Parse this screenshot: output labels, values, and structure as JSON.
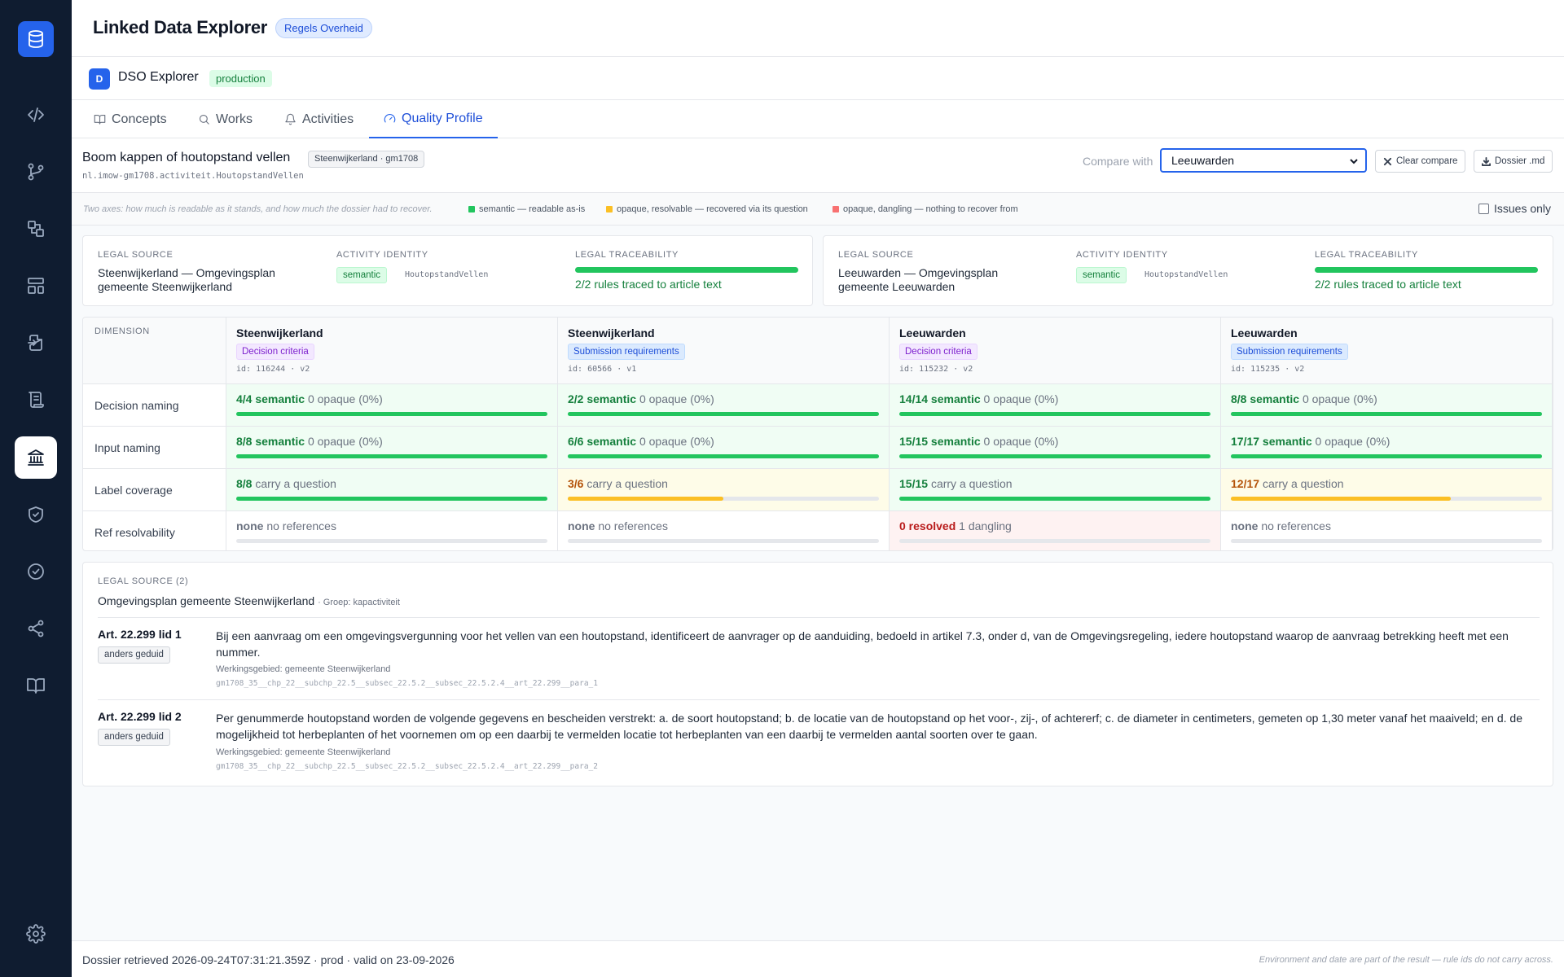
{
  "app": {
    "title": "Linked Data Explorer",
    "context_badge": "Regels Overheid"
  },
  "sidebar": {
    "items": [
      {
        "name": "code-icon"
      },
      {
        "name": "git-branch-icon"
      },
      {
        "name": "shapes-icon"
      },
      {
        "name": "layout-icon"
      },
      {
        "name": "file-import-icon"
      },
      {
        "name": "scroll-icon"
      },
      {
        "name": "landmark-icon",
        "active": true
      },
      {
        "name": "shield-check-icon"
      },
      {
        "name": "circle-check-icon"
      },
      {
        "name": "share-icon"
      },
      {
        "name": "book-open-icon"
      },
      {
        "name": "settings-icon"
      }
    ]
  },
  "environment": {
    "avatar": "D",
    "name": "DSO Explorer",
    "badge": "production"
  },
  "tabs": [
    {
      "label": "Concepts",
      "icon": "book-icon"
    },
    {
      "label": "Works",
      "icon": "search-icon"
    },
    {
      "label": "Activities",
      "icon": "bell-icon"
    },
    {
      "label": "Quality Profile",
      "icon": "gauge-icon",
      "active": true
    }
  ],
  "activity": {
    "title": "Boom kappen of houtopstand vellen",
    "chip": "Steenwijkerland · gm1708",
    "id": "nl.imow-gm1708.activiteit.HoutopstandVellen"
  },
  "compare": {
    "label": "Compare with",
    "selected": "Leeuwarden",
    "clear_label": "Clear compare",
    "dossier_label": "Dossier .md"
  },
  "legend": {
    "intro": "Two axes: how much is readable as it stands, and how much the dossier had to recover.",
    "items": [
      {
        "label": "semantic — readable as-is",
        "color": "#22c55e"
      },
      {
        "label": "opaque, resolvable — recovered via its question",
        "color": "#fbbf24"
      },
      {
        "label": "opaque, dangling — nothing to recover from",
        "color": "#f87171"
      }
    ],
    "issues_only": "Issues only"
  },
  "cards": [
    {
      "legal_source_label": "LEGAL SOURCE",
      "legal_source": "Steenwijkerland — Omgevingsplan gemeente Steenwijkerland",
      "identity_label": "ACTIVITY IDENTITY",
      "identity_badge": "semantic",
      "identity_id": "HoutopstandVellen",
      "trace_label": "LEGAL TRACEABILITY",
      "trace_text": "2/2 rules traced to article text",
      "trace_fraction": 1.0
    },
    {
      "legal_source_label": "LEGAL SOURCE",
      "legal_source": "Leeuwarden — Omgevingsplan gemeente Leeuwarden",
      "identity_label": "ACTIVITY IDENTITY",
      "identity_badge": "semantic",
      "identity_id": "HoutopstandVellen",
      "trace_label": "LEGAL TRACEABILITY",
      "trace_text": "2/2 rules traced to article text",
      "trace_fraction": 1.0
    }
  ],
  "matrix": {
    "dimension_header": "DIMENSION",
    "columns": [
      {
        "name": "Steenwijkerland",
        "badge": "Decision criteria",
        "badge_tone": "purple",
        "id": "id: 116244 · v2"
      },
      {
        "name": "Steenwijkerland",
        "badge": "Submission requirements",
        "badge_tone": "blue",
        "id": "id: 60566 · v1"
      },
      {
        "name": "Leeuwarden",
        "badge": "Decision criteria",
        "badge_tone": "purple",
        "id": "id: 115232 · v2"
      },
      {
        "name": "Leeuwarden",
        "badge": "Submission requirements",
        "badge_tone": "blue",
        "id": "id: 115235 · v2"
      }
    ],
    "rows": [
      {
        "label": "Decision naming",
        "cells": [
          {
            "strong": "4/4 semantic",
            "rest": "0 opaque (0%)",
            "tone": "green",
            "fill": 1.0,
            "fill_color": "#22c55e"
          },
          {
            "strong": "2/2 semantic",
            "rest": "0 opaque (0%)",
            "tone": "green",
            "fill": 1.0,
            "fill_color": "#22c55e"
          },
          {
            "strong": "14/14 semantic",
            "rest": "0 opaque (0%)",
            "tone": "green",
            "fill": 1.0,
            "fill_color": "#22c55e"
          },
          {
            "strong": "8/8 semantic",
            "rest": "0 opaque (0%)",
            "tone": "green",
            "fill": 1.0,
            "fill_color": "#22c55e"
          }
        ]
      },
      {
        "label": "Input naming",
        "cells": [
          {
            "strong": "8/8 semantic",
            "rest": "0 opaque (0%)",
            "tone": "green",
            "fill": 1.0,
            "fill_color": "#22c55e"
          },
          {
            "strong": "6/6 semantic",
            "rest": "0 opaque (0%)",
            "tone": "green",
            "fill": 1.0,
            "fill_color": "#22c55e"
          },
          {
            "strong": "15/15 semantic",
            "rest": "0 opaque (0%)",
            "tone": "green",
            "fill": 1.0,
            "fill_color": "#22c55e"
          },
          {
            "strong": "17/17 semantic",
            "rest": "0 opaque (0%)",
            "tone": "green",
            "fill": 1.0,
            "fill_color": "#22c55e"
          }
        ]
      },
      {
        "label": "Label coverage",
        "cells": [
          {
            "strong": "8/8",
            "rest": "carry a question",
            "tone": "green",
            "fill": 1.0,
            "fill_color": "#22c55e"
          },
          {
            "strong": "3/6",
            "rest": "carry a question",
            "tone": "yellow",
            "fill": 0.5,
            "fill_color": "#fbbf24"
          },
          {
            "strong": "15/15",
            "rest": "carry a question",
            "tone": "green",
            "fill": 1.0,
            "fill_color": "#22c55e"
          },
          {
            "strong": "12/17",
            "rest": "carry a question",
            "tone": "yellow",
            "fill": 0.706,
            "fill_color": "#fbbf24"
          }
        ]
      },
      {
        "label": "Ref resolvability",
        "cells": [
          {
            "strong": "none",
            "rest": "no references",
            "tone": "plain",
            "fill": 0,
            "fill_color": "#22c55e"
          },
          {
            "strong": "none",
            "rest": "no references",
            "tone": "plain",
            "fill": 0,
            "fill_color": "#22c55e"
          },
          {
            "strong": "0 resolved",
            "rest": "1 dangling",
            "tone": "red",
            "fill": 0,
            "fill_color": "#f87171"
          },
          {
            "strong": "none",
            "rest": "no references",
            "tone": "plain",
            "fill": 0,
            "fill_color": "#22c55e"
          }
        ]
      }
    ]
  },
  "legal_sources": {
    "header": "LEGAL SOURCE (2)",
    "source": "Omgevingsplan gemeente Steenwijkerland",
    "group": "· Groep: kapactiviteit",
    "articles": [
      {
        "number": "Art. 22.299 lid 1",
        "badge": "anders geduid",
        "text": "Bij een aanvraag om een omgevingsvergunning voor het vellen van een houtopstand, identificeert de aanvrager op de aanduiding, bedoeld in artikel 7.3, onder d, van de Omgevingsregeling, iedere houtopstand waarop de aanvraag betrekking heeft met een nummer.",
        "scope": "Werkingsgebied: gemeente Steenwijkerland",
        "path": "gm1708_35__chp_22__subchp_22.5__subsec_22.5.2__subsec_22.5.2.4__art_22.299__para_1"
      },
      {
        "number": "Art. 22.299 lid 2",
        "badge": "anders geduid",
        "text": "Per genummerde houtopstand worden de volgende gegevens en bescheiden verstrekt: a. de soort houtopstand; b. de locatie van de houtopstand op het voor-, zij-, of achtererf; c. de diameter in centimeters, gemeten op 1,30 meter vanaf het maaiveld; en d. de mogelijkheid tot herbeplanten of het voornemen om op een daarbij te vermelden locatie tot herbeplanten van een daarbij te vermelden aantal soorten over te gaan.",
        "scope": "Werkingsgebied: gemeente Steenwijkerland",
        "path": "gm1708_35__chp_22__subchp_22.5__subsec_22.5.2__subsec_22.5.2.4__art_22.299__para_2"
      }
    ]
  },
  "footer": {
    "left": "Dossier retrieved 2026-09-24T07:31:21.359Z · prod · valid on 23-09-2026",
    "right": "Environment and date are part of the result — rule ids do not carry across."
  }
}
